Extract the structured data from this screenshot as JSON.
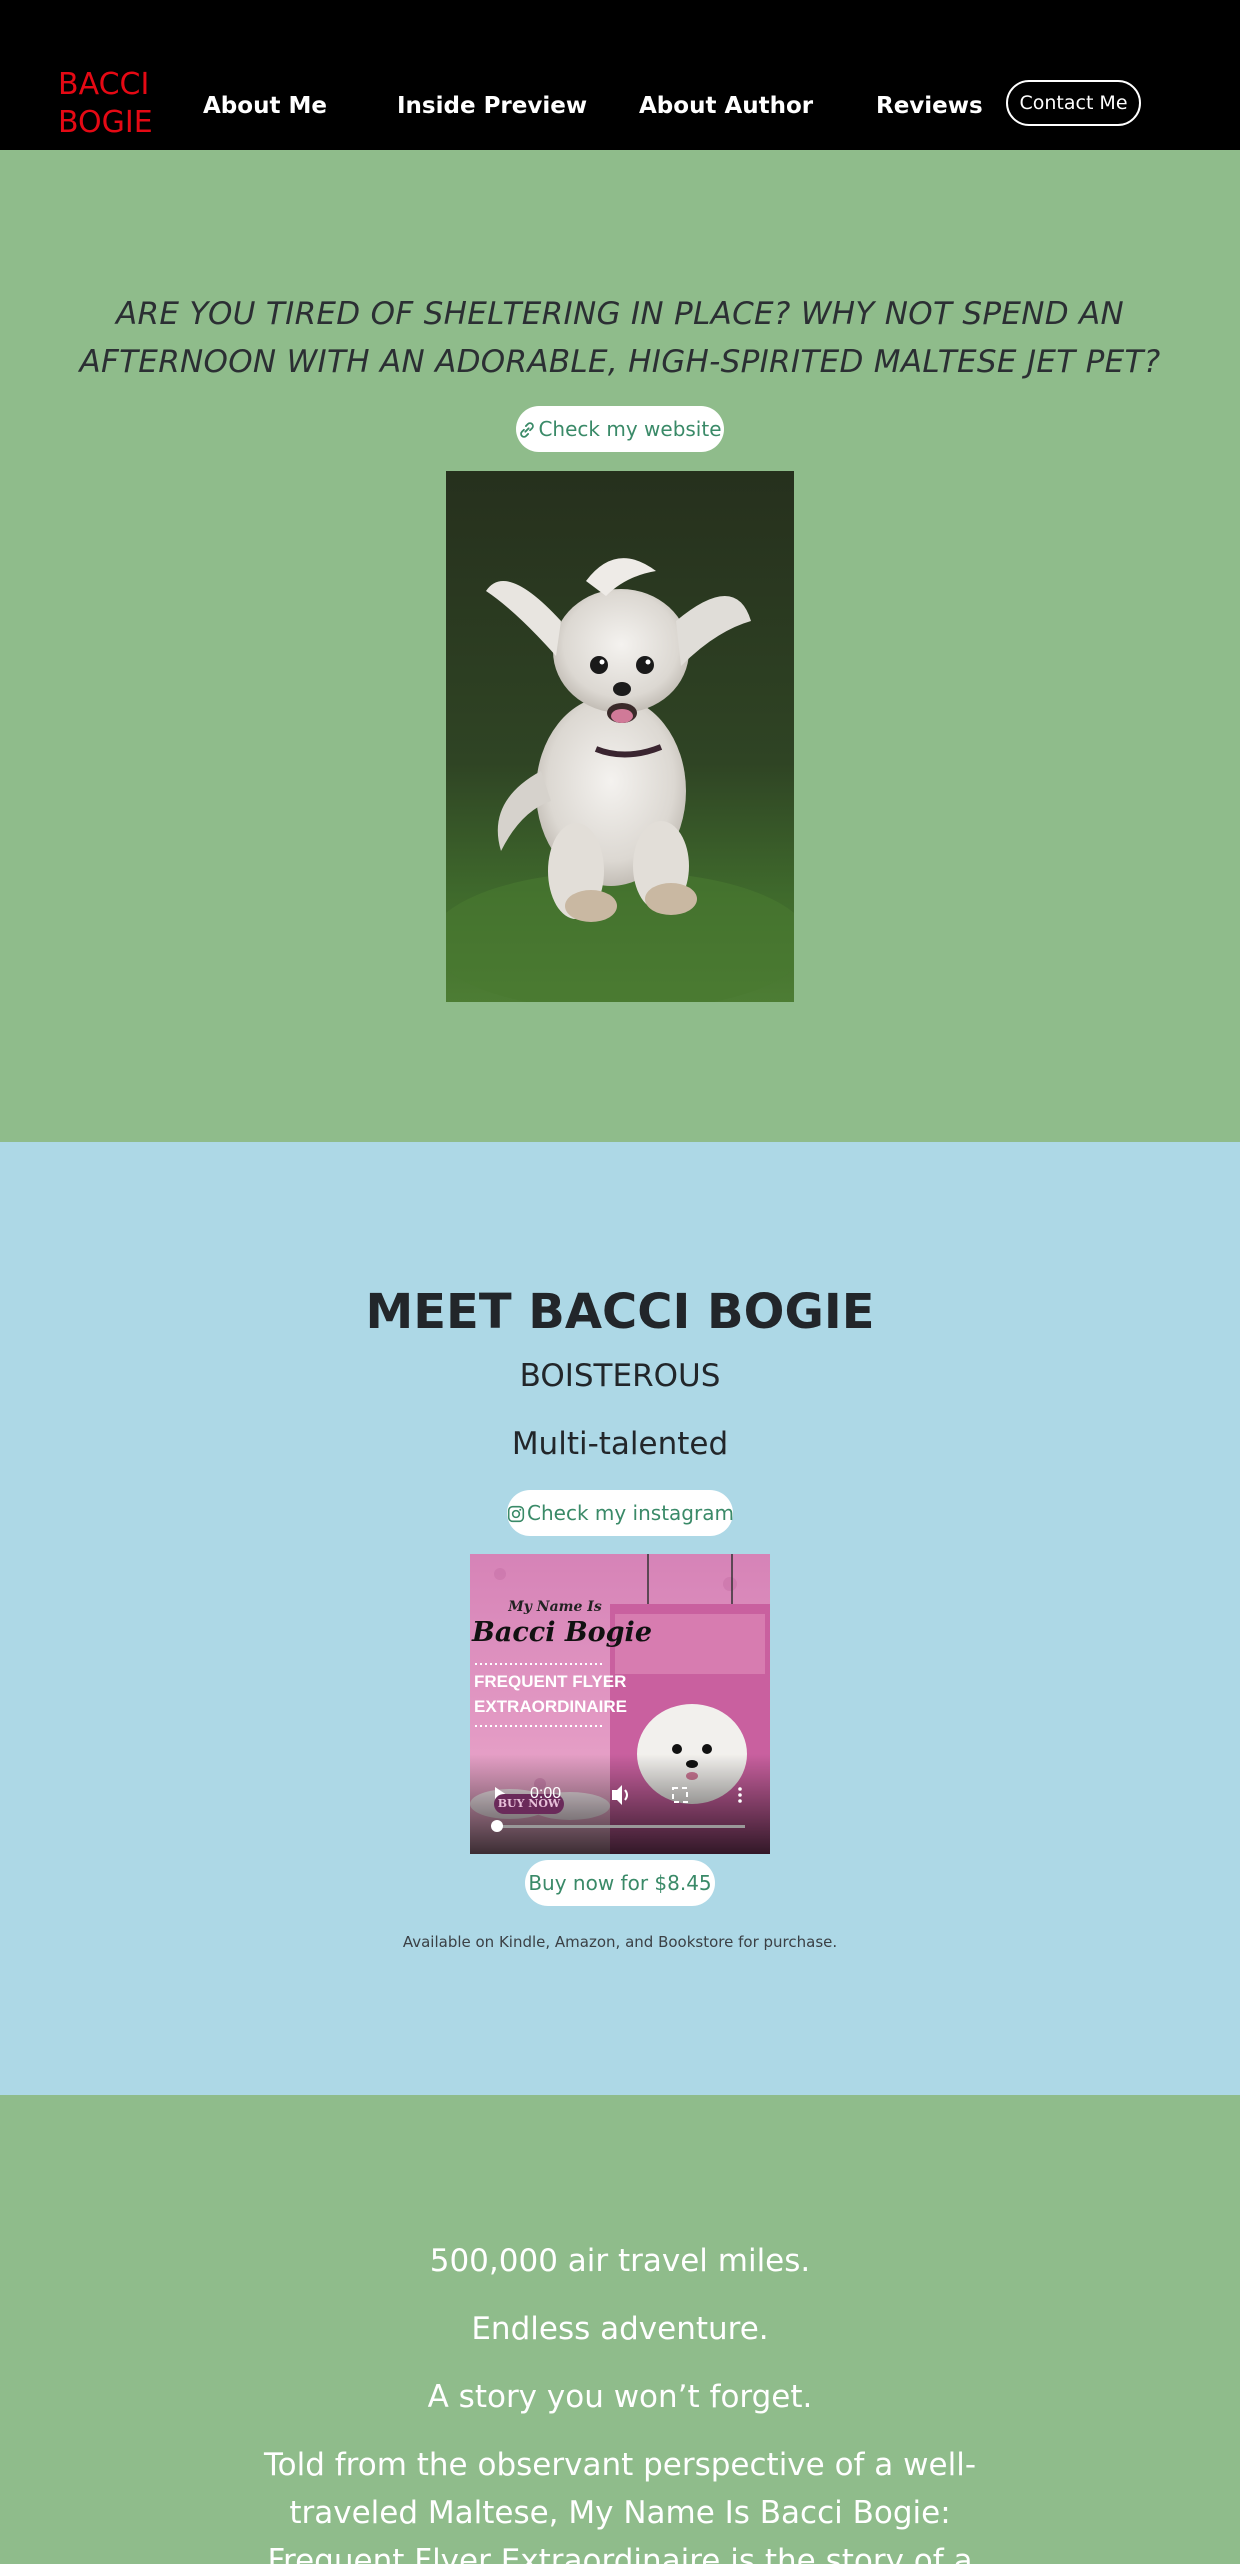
{
  "colors": {
    "nav_bg": "#000000",
    "brand": "#e50914",
    "hero_bg": "#8fbc8b",
    "meet_bg": "#add8e6",
    "button_text": "#3a8a68"
  },
  "nav": {
    "brand_line1": "BACCI",
    "brand_line2": "BOGIE",
    "links": [
      "About Me",
      "Inside Preview",
      "About Author",
      "Reviews"
    ],
    "contact_label": "Contact Me"
  },
  "hero": {
    "tagline": "ARE YOU TIRED OF SHELTERING IN PLACE? WHY NOT SPEND AN AFTERNOON WITH AN ADORABLE, HIGH-SPIRITED MALTESE JET PET?",
    "website_button": "Check my website",
    "website_icon": "link-icon"
  },
  "meet": {
    "title": "MEET BACCI BOGIE",
    "subtitle1": "BOISTEROUS",
    "subtitle2": "Multi-talented",
    "instagram_button": "Check my instagram",
    "instagram_icon": "instagram-icon",
    "video": {
      "cover_line1": "My Name Is",
      "cover_line2": "Bacci Bogie",
      "cover_line3": "FREQUENT FLYER",
      "cover_line4": "EXTRAORDINAIRE",
      "cover_badge": "BUY NOW",
      "time": "0:00",
      "progress": 0
    },
    "buy_button": "Buy now for $8.45",
    "availability": "Available on Kindle, Amazon, and Bookstore for purchase."
  },
  "story": {
    "line1": "500,000 air travel miles.",
    "line2": "Endless adventure.",
    "line3": "A story you won’t forget.",
    "body": "Told from the observant perspective of a well-traveled Maltese, My Name Is Bacci Bogie: Frequent Flyer Extraordinaire is the story of a human-canine duo with"
  }
}
